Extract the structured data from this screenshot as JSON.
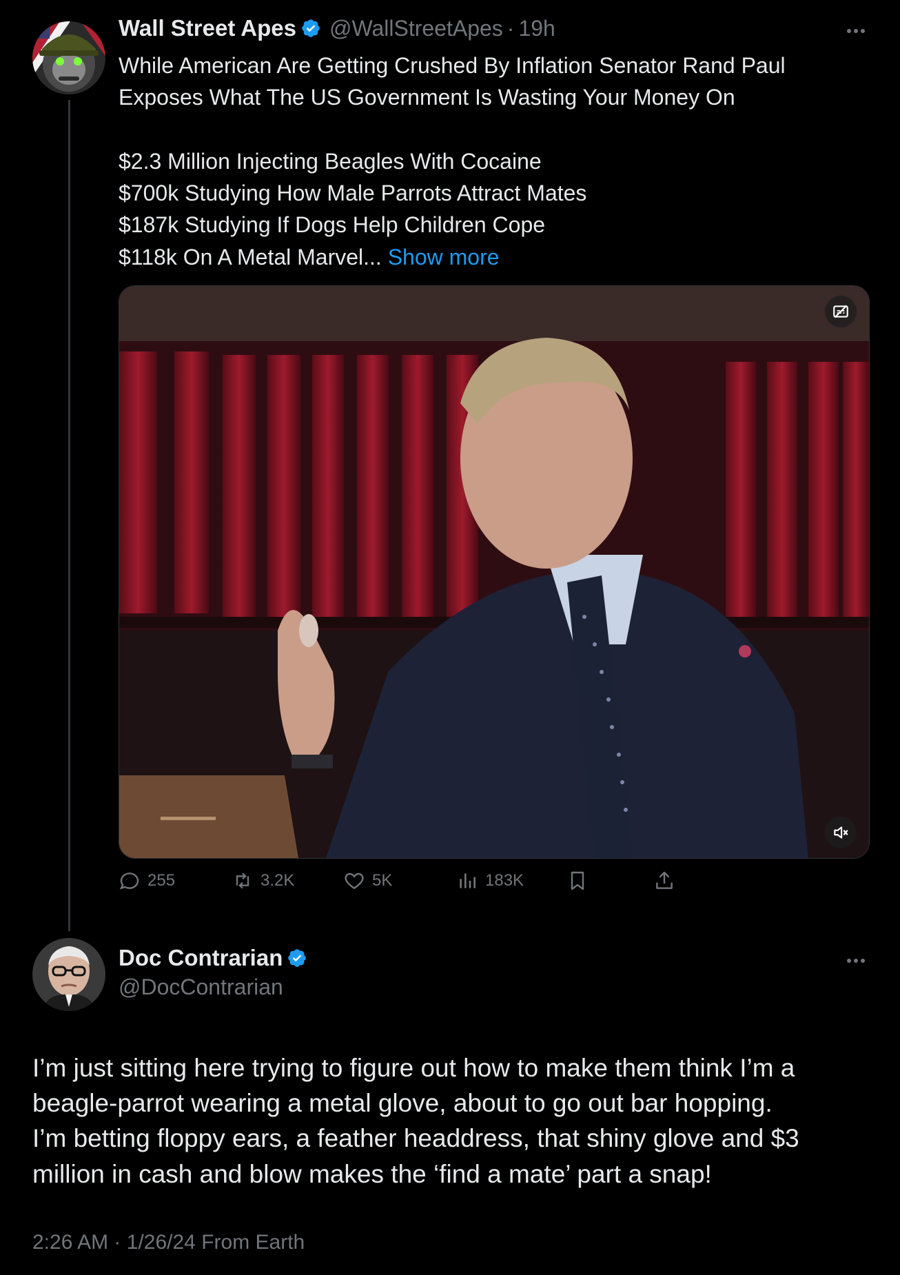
{
  "original_tweet": {
    "author_name": "Wall Street Apes",
    "handle": "@WallStreetApes",
    "separator": "·",
    "time": "19h",
    "text_lines": [
      "While American Are Getting Crushed By Inflation Senator Rand Paul",
      "Exposes What The US Government Is Wasting Your Money On",
      "",
      "$2.3 Million Injecting Beagles With Cocaine",
      "$700k Studying How Male Parrots Attract Mates",
      "$187k Studying If Dogs Help Children Cope",
      "$118k On A Metal Marvel... "
    ],
    "show_more": "Show more",
    "metrics": {
      "replies": "255",
      "retweets": "3.2K",
      "likes": "5K",
      "views": "183K"
    }
  },
  "reply_tweet": {
    "author_name": "Doc Contrarian",
    "handle": "@DocContrarian",
    "text_lines": [
      "I’m just sitting here trying to figure out how to make them think I’m a",
      "beagle-parrot wearing a metal glove, about to go out bar hopping.",
      "I’m betting floppy ears, a feather headdress, that shiny glove and $3",
      "million in cash and blow makes the ‘find a mate’ part a snap!"
    ],
    "timestamp": "2:26 AM",
    "separator": "·",
    "date": "1/26/24",
    "source": "From Earth"
  },
  "icons": {
    "verified": "verified-badge-icon",
    "more": "more-horizontal-icon",
    "reply": "reply-icon",
    "retweet": "retweet-icon",
    "like": "heart-icon",
    "views": "views-icon",
    "bookmark": "bookmark-icon",
    "share": "share-icon",
    "captions": "captions-icon",
    "mute": "mute-icon"
  },
  "colors": {
    "background": "#000000",
    "accent": "#1d9bf0",
    "text": "#e7e9ea",
    "muted": "#71767b"
  }
}
